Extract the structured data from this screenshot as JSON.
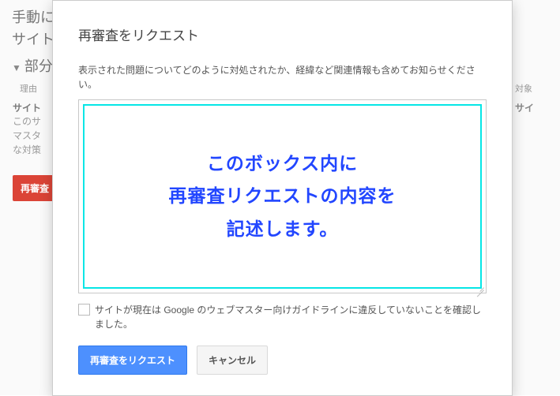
{
  "background": {
    "line1": "手動に",
    "line2": "サイト",
    "section": "部分",
    "reason_label": "理由",
    "target_label": "対象",
    "site_label": "サイ",
    "side_title": "サイト",
    "side_text": "このサ マスタ な対策",
    "red_button": "再審査"
  },
  "modal": {
    "title": "再審査をリクエスト",
    "instruction": "表示された問題についてどのように対処されたか、経緯など関連情報も含めてお知らせください。",
    "textarea_value": "",
    "overlay_text": "このボックス内に\n再審査リクエストの内容を\n記述します。",
    "checkbox_label": "サイトが現在は Google のウェブマスター向けガイドラインに違反していないことを確認しました。",
    "submit_label": "再審査をリクエスト",
    "cancel_label": "キャンセル"
  }
}
